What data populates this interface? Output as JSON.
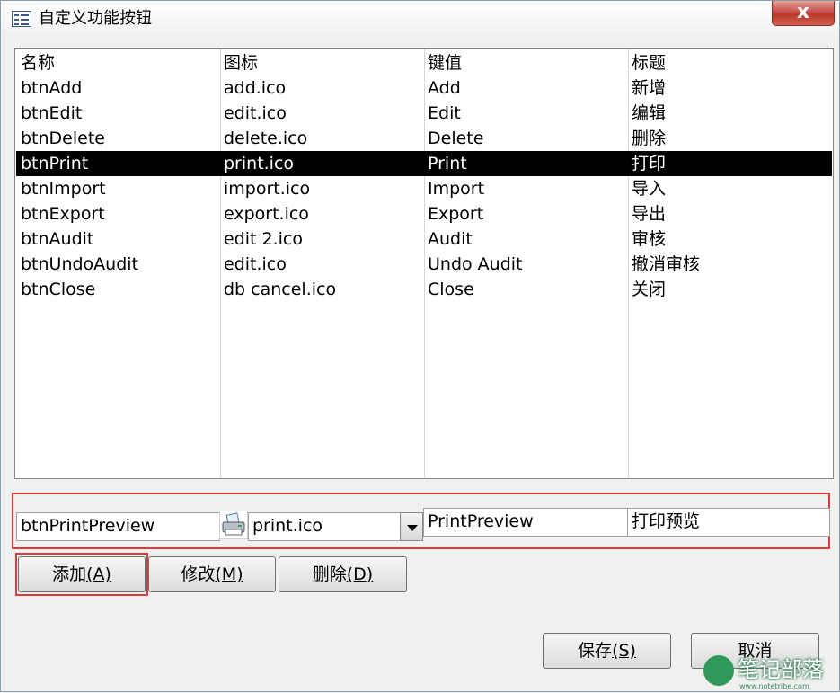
{
  "window": {
    "title": "自定义功能按钮",
    "close_label": "x"
  },
  "list": {
    "columns": [
      "名称",
      "图标",
      "键值",
      "标题"
    ],
    "rows": [
      [
        "btnAdd",
        "add.ico",
        "Add",
        "新增"
      ],
      [
        "btnEdit",
        "edit.ico",
        "Edit",
        "编辑"
      ],
      [
        "btnDelete",
        "delete.ico",
        "Delete",
        "删除"
      ],
      [
        "btnPrint",
        "print.ico",
        "Print",
        "打印"
      ],
      [
        "btnImport",
        "import.ico",
        "Import",
        "导入"
      ],
      [
        "btnExport",
        "export.ico",
        "Export",
        "导出"
      ],
      [
        "btnAudit",
        "edit 2.ico",
        "Audit",
        "审核"
      ],
      [
        "btnUndoAudit",
        "edit.ico",
        "Undo Audit",
        "撤消审核"
      ],
      [
        "btnClose",
        "db cancel.ico",
        "Close",
        "关闭"
      ]
    ],
    "selected_row": 3
  },
  "edit": {
    "name_value": "btnPrintPreview",
    "icon_value": "print.ico",
    "icon_name": "printer-icon",
    "key_value": "PrintPreview",
    "caption_value": "打印预览"
  },
  "buttons": {
    "add": {
      "label": "添加",
      "mnemonic": "(A)"
    },
    "modify": {
      "label": "修改",
      "mnemonic": "(M)"
    },
    "delete": {
      "label": "删除",
      "mnemonic": "(D)"
    },
    "save": {
      "label": "保存",
      "mnemonic": "(S)"
    },
    "cancel": {
      "label": "取消"
    }
  },
  "watermark": {
    "text": "笔记部落",
    "url": "www.notetribe.com"
  },
  "colors": {
    "highlight_border": "#e03a3a",
    "selected_row_bg": "#000000",
    "close_button": "#c75050"
  }
}
